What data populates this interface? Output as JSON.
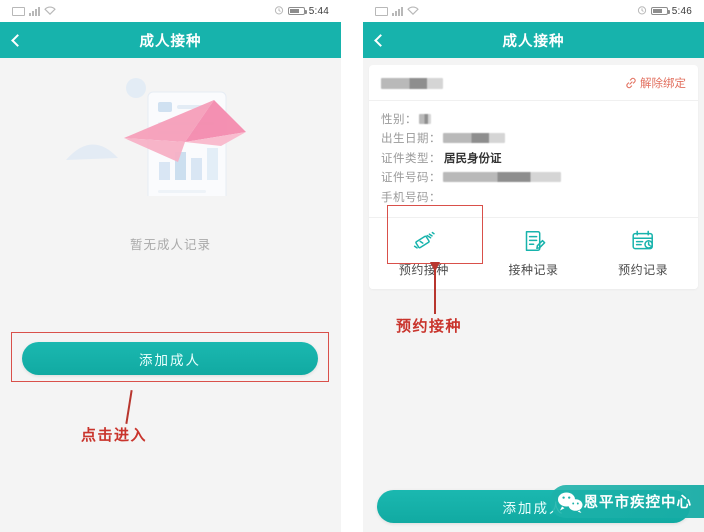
{
  "left_phone": {
    "status_bar": {
      "time": "5:44",
      "icons": [
        "sim-card-icon",
        "signal-bars-icon",
        "wifi-icon",
        "alarm-clock-icon",
        "battery-icon"
      ]
    },
    "header": {
      "title": "成人接种",
      "back_icon": "chevron-left-icon",
      "bg_color": "#17b3ac"
    },
    "empty_state": {
      "illustration": "paper-plane-illustration",
      "message": "暂无成人记录"
    },
    "primary_button": {
      "label": "添加成人",
      "color": "#15b0a8"
    },
    "annotation": {
      "text": "点击进入",
      "color": "#c9342c",
      "highlight": "red-rectangle-around-add-adult-button"
    }
  },
  "right_phone": {
    "status_bar": {
      "time": "5:46",
      "icons": [
        "sim-card-icon",
        "signal-bars-icon",
        "wifi-icon",
        "alarm-clock-icon",
        "battery-icon"
      ]
    },
    "header": {
      "title": "成人接种",
      "back_icon": "chevron-left-icon",
      "bg_color": "#17b3ac"
    },
    "profile_card": {
      "name": "",
      "name_redacted": true,
      "unbind_label": "解除绑定",
      "unbind_color": "#e2705f",
      "fields": [
        {
          "label": "性别：",
          "value": "",
          "redacted": true
        },
        {
          "label": "出生日期：",
          "value": "",
          "redacted": true
        },
        {
          "label": "证件类型：",
          "value": "居民身份证",
          "redacted": false
        },
        {
          "label": "证件号码：",
          "value": "",
          "redacted": true
        },
        {
          "label": "手机号码：",
          "value": "",
          "redacted": false
        }
      ]
    },
    "tiles": [
      {
        "label": "预约接种",
        "icon": "syringe-icon",
        "highlighted": true
      },
      {
        "label": "接种记录",
        "icon": "document-edit-icon",
        "highlighted": false
      },
      {
        "label": "预约记录",
        "icon": "calendar-clock-icon",
        "highlighted": false
      }
    ],
    "annotation": {
      "text": "预约接种",
      "color": "#c9342c",
      "highlight": "red-rectangle-around-book-vaccination-tile"
    },
    "primary_button": {
      "label": "添加成人",
      "color": "#15b0a8"
    }
  },
  "watermark": {
    "text": "恩平市疾控中心",
    "icon": "wechat-icon",
    "bg_color": "#1cb2aa"
  }
}
